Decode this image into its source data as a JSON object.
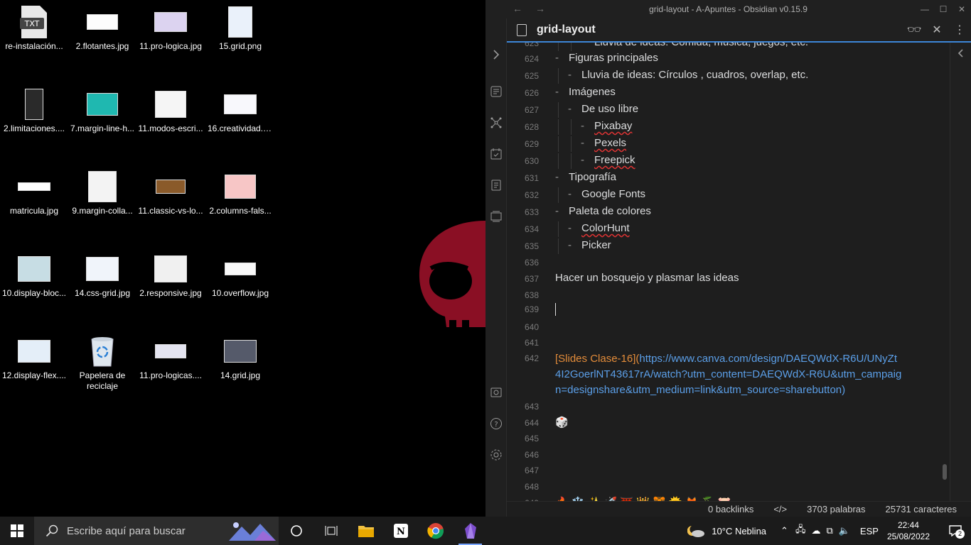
{
  "desktop": {
    "icons": [
      {
        "label": "re-instalación...",
        "kind": "txt",
        "badge": "TXT"
      },
      {
        "label": "2.flotantes.jpg"
      },
      {
        "label": "11.pro-logica.jpg"
      },
      {
        "label": "15.grid.png"
      },
      {
        "label": "2.limitaciones...."
      },
      {
        "label": "7.margin-line-h..."
      },
      {
        "label": "11.modos-escri..."
      },
      {
        "label": "16.creatividad.jpg"
      },
      {
        "label": "matricula.jpg"
      },
      {
        "label": "9.margin-colla..."
      },
      {
        "label": "11.classic-vs-lo..."
      },
      {
        "label": "2.columns-fals..."
      },
      {
        "label": "10.display-bloc..."
      },
      {
        "label": "14.css-grid.jpg"
      },
      {
        "label": "2.responsive.jpg"
      },
      {
        "label": "10.overflow.jpg"
      },
      {
        "label": "12.display-flex...."
      },
      {
        "label": "Papelera de reciclaje"
      },
      {
        "label": "11.pro-logicas...."
      },
      {
        "label": "14.grid.jpg"
      }
    ]
  },
  "obsidian": {
    "window_title": "grid-layout - A-Apuntes - Obsidian v0.15.9",
    "tab_title": "grid-layout",
    "lines": [
      {
        "n": "623",
        "indent": 2,
        "text": "Lluvia de ideas: Comida, música, juegos, etc."
      },
      {
        "n": "624",
        "indent": 0,
        "text": "Figuras principales",
        "bullet": true
      },
      {
        "n": "625",
        "indent": 1,
        "text": "Lluvia de ideas: Círculos , cuadros, overlap, etc.",
        "bullet": true
      },
      {
        "n": "626",
        "indent": 0,
        "text": "Imágenes",
        "bullet": true
      },
      {
        "n": "627",
        "indent": 1,
        "text": "De uso libre",
        "bullet": true
      },
      {
        "n": "628",
        "indent": 2,
        "text": "Pixabay",
        "bullet": true,
        "spell": true
      },
      {
        "n": "629",
        "indent": 2,
        "text": "Pexels",
        "bullet": true,
        "spell": true
      },
      {
        "n": "630",
        "indent": 2,
        "text": "Freepick",
        "bullet": true,
        "spell": true
      },
      {
        "n": "631",
        "indent": 0,
        "text": "Tipografía",
        "bullet": true
      },
      {
        "n": "632",
        "indent": 1,
        "text": "Google Fonts",
        "bullet": true
      },
      {
        "n": "633",
        "indent": 0,
        "text": "Paleta de colores",
        "bullet": true
      },
      {
        "n": "634",
        "indent": 1,
        "text": "ColorHunt",
        "bullet": true,
        "spell": true
      },
      {
        "n": "635",
        "indent": 1,
        "text": "Picker",
        "bullet": true
      },
      {
        "n": "636",
        "text": ""
      },
      {
        "n": "637",
        "text": "Hacer un bosquejo y plasmar las ideas"
      },
      {
        "n": "638",
        "text": ""
      },
      {
        "n": "639",
        "text": "",
        "cursor": true
      },
      {
        "n": "640",
        "text": ""
      },
      {
        "n": "641",
        "text": ""
      }
    ],
    "link_line": {
      "n": "642",
      "open_bracket": "[",
      "link_text": "Slides Clase-16",
      "close_bracket": "](",
      "url_1": "https://www.canva.com/design/DAEQWdX-R6U/UNyZt",
      "url_2": "4I2GoerlNT43617rA/watch?utm_content=DAEQWdX-R6U&utm_campaig",
      "url_3": "n=designshare&utm_medium=link&utm_source=sharebutton)"
    },
    "lines_after": [
      {
        "n": "643",
        "text": ""
      },
      {
        "n": "644",
        "text": "🎲"
      },
      {
        "n": "645",
        "text": ""
      },
      {
        "n": "646",
        "text": ""
      },
      {
        "n": "647",
        "text": ""
      },
      {
        "n": "648",
        "text": ""
      },
      {
        "n": "649",
        "text": "🔥 ❄️ ✨ 🚀 ⛩️ 👑 🐯 🌞 🦊 🍒 🐷"
      }
    ],
    "status": {
      "backlinks": "0 backlinks",
      "code_icon": "</>",
      "words": "3703 palabras",
      "chars": "25731 caracteres"
    }
  },
  "taskbar": {
    "search_placeholder": "Escribe aquí para buscar",
    "weather": "10°C  Neblina",
    "lang": "ESP",
    "time": "22:44",
    "date": "25/08/2022",
    "notif_count": "2"
  }
}
